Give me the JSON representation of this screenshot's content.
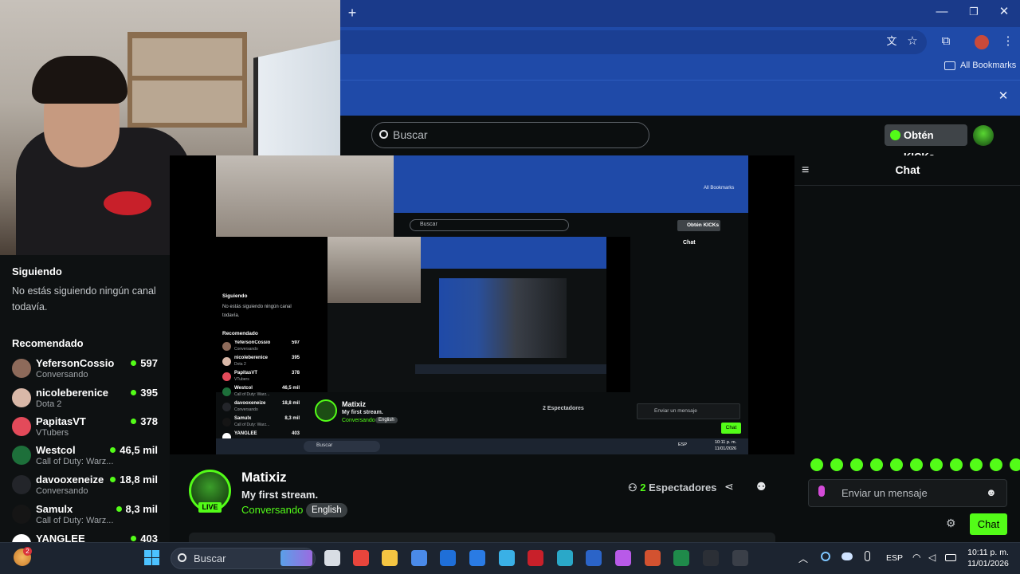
{
  "browser": {
    "new_tab": "+",
    "window_controls": [
      "—",
      "❐",
      "✕"
    ],
    "bookmarks_label": "All Bookmarks",
    "infobar_close": "✕"
  },
  "header": {
    "search_placeholder": "Buscar",
    "kicks_button": "Obtén KICKs"
  },
  "sidebar": {
    "following_title": "Siguiendo",
    "following_empty": "No estás siguiendo ningún canal todavía.",
    "recommended_title": "Recomendado",
    "items": [
      {
        "name": "YefersonCossio",
        "category": "Conversando",
        "viewers": "597",
        "color": "#8d6a5a"
      },
      {
        "name": "nicoleberenice",
        "category": "Dota 2",
        "viewers": "395",
        "color": "#d9b8a8"
      },
      {
        "name": "PapitasVT",
        "category": "VTubers",
        "viewers": "378",
        "color": "#e34a5a"
      },
      {
        "name": "Westcol",
        "category": "Call of Duty: Warz...",
        "viewers": "46,5 mil",
        "color": "#1d6f3a"
      },
      {
        "name": "davooxeneize",
        "category": "Conversando",
        "viewers": "18,8 mil",
        "color": "#23252a"
      },
      {
        "name": "Samulx",
        "category": "Call of Duty: Warz...",
        "viewers": "8,3 mil",
        "color": "#151515"
      },
      {
        "name": "YANGLEE",
        "category": "",
        "viewers": "403",
        "color": "#ffffff"
      }
    ]
  },
  "channel": {
    "name": "Matixiz",
    "title": "My first stream.",
    "category": "Conversando",
    "language": "English",
    "live": "LIVE",
    "viewers_count": "2",
    "viewers_label": "Espectadores"
  },
  "chat": {
    "title": "Chat",
    "input_placeholder": "Enviar un mensaje",
    "send_label": "Chat"
  },
  "nested": {
    "chat_title": "Chat",
    "kicks": "Obtén KICKs",
    "bookmarks": "All Bookmarks",
    "search": "Buscar",
    "following": "Siguiendo",
    "following_empty": "No estás siguiendo ningún canal todavía.",
    "recommended": "Recomendado",
    "items": [
      {
        "name": "YefersonCossio",
        "cat": "Conversando",
        "v": "597"
      },
      {
        "name": "nicoleberenice",
        "cat": "Dota 2",
        "v": "395"
      },
      {
        "name": "PapitasVT",
        "cat": "VTubers",
        "v": "378"
      },
      {
        "name": "Westcol",
        "cat": "Call of Duty: Warz...",
        "v": "46,5 mil"
      },
      {
        "name": "davooxeneize",
        "cat": "Conversando",
        "v": "18,8 mil"
      },
      {
        "name": "Samulx",
        "cat": "Call of Duty: Warz...",
        "v": "8,3 mil"
      },
      {
        "name": "YANGLEE",
        "cat": "",
        "v": "403"
      }
    ],
    "channel_name": "Matixiz",
    "channel_title": "My first stream.",
    "channel_cat": "Conversando",
    "channel_lang": "English",
    "viewers": "2 Espectadores",
    "chat_input": "Enviar un mensaje",
    "send": "Chat",
    "taskbar_search": "Buscar",
    "lang": "ESP",
    "time": "10:11 p. m.",
    "date": "11/01/2026"
  },
  "taskbar": {
    "search_placeholder": "Buscar",
    "notification_badge": "2",
    "language": "ESP",
    "time": "10:11 p. m.",
    "date": "11/01/2026"
  },
  "colors": {
    "kick_green": "#53fc18",
    "browser_blue": "#1f4aa8",
    "page_bg": "#0b0e0f"
  }
}
